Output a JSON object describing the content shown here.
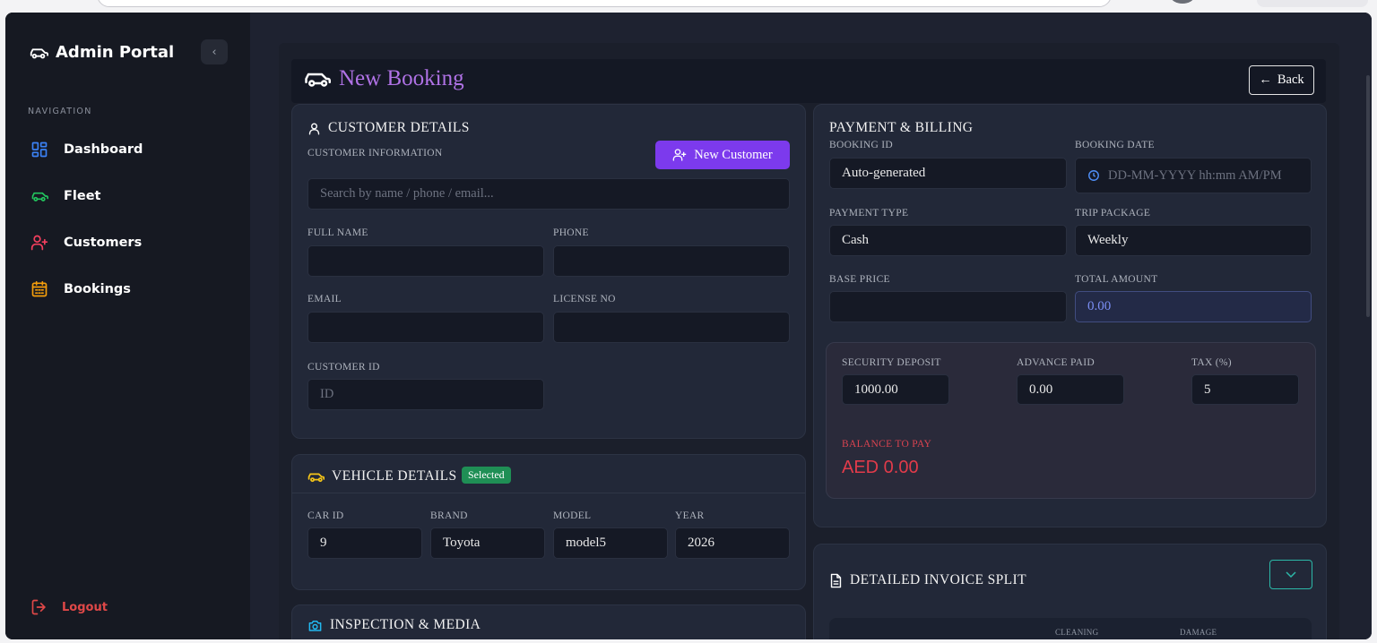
{
  "sidebar": {
    "brand": "Admin Portal",
    "nav_header": "NAVIGATION",
    "items": [
      {
        "label": "Dashboard",
        "icon": "dashboard-icon",
        "color": "#3b82f6"
      },
      {
        "label": "Fleet",
        "icon": "car-icon",
        "color": "#22c55e"
      },
      {
        "label": "Customers",
        "icon": "user-plus-icon",
        "color": "#f43f5e"
      },
      {
        "label": "Bookings",
        "icon": "calendar-icon",
        "color": "#f59e0b"
      }
    ],
    "logout": "Logout"
  },
  "header": {
    "title": "New Booking",
    "back": "Back"
  },
  "customer": {
    "title": "CUSTOMER DETAILS",
    "info_label": "CUSTOMER INFORMATION",
    "new_customer": "New Customer",
    "search_placeholder": "Search by name / phone / email...",
    "full_name_label": "FULL NAME",
    "phone_label": "PHONE",
    "email_label": "EMAIL",
    "license_label": "LICENSE NO",
    "customer_id_label": "CUSTOMER ID",
    "customer_id_placeholder": "ID"
  },
  "vehicle": {
    "title": "VEHICLE DETAILS",
    "badge": "Selected",
    "car_id_label": "CAR ID",
    "car_id": "9",
    "brand_label": "BRAND",
    "brand": "Toyota",
    "model_label": "MODEL",
    "model": "model5",
    "year_label": "YEAR",
    "year": "2026"
  },
  "inspection": {
    "title": "INSPECTION & MEDIA"
  },
  "payment": {
    "title": "PAYMENT & BILLING",
    "booking_id_label": "BOOKING ID",
    "booking_id": "Auto-generated",
    "booking_date_label": "BOOKING DATE",
    "booking_date_placeholder": "DD-MM-YYYY hh:mm AM/PM",
    "payment_type_label": "PAYMENT TYPE",
    "payment_type": "Cash",
    "trip_package_label": "TRIP PACKAGE",
    "trip_package": "Weekly",
    "base_price_label": "BASE PRICE",
    "total_amount_label": "TOTAL AMOUNT",
    "total_amount": "0.00",
    "security_deposit_label": "SECURITY DEPOSIT",
    "security_deposit": "1000.00",
    "advance_paid_label": "ADVANCE PAID",
    "advance_paid": "0.00",
    "tax_label": "TAX (%)",
    "tax": "5",
    "balance_label": "BALANCE TO PAY",
    "balance": "AED 0.00"
  },
  "invoice": {
    "title": "DETAILED INVOICE SPLIT",
    "col_cleaning": "CLEANING",
    "col_damage": "DAMAGE"
  },
  "colors": {
    "accent_purple": "#7c3aed",
    "title_purple": "#b072e6",
    "danger": "#e04848",
    "success": "#1f8f55",
    "teal": "#2cb8a8"
  }
}
